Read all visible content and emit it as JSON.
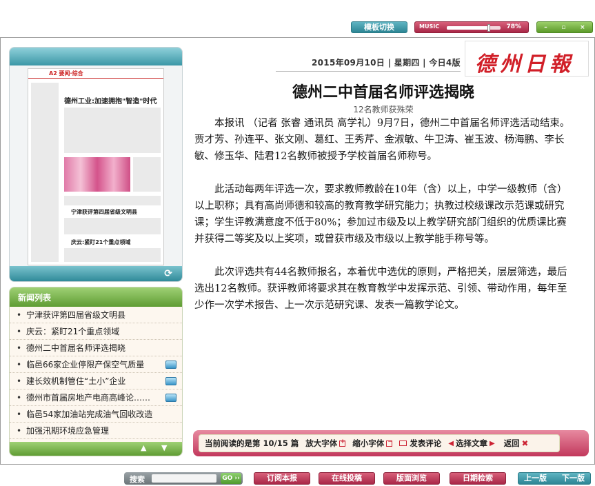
{
  "topbar": {
    "template_switch": "模板切换",
    "music_label": "MUSIC",
    "music_volume_text": "78%",
    "music_volume": 0.78,
    "window_controls": [
      "–",
      "▫",
      "×"
    ]
  },
  "header": {
    "date": "2015年09月10日",
    "weekday": "星期四",
    "today_pages": "今日4版",
    "logo": "德州日報"
  },
  "thumbnail": {
    "page_label": "A2 要闻·综合",
    "headline1": "德州工业:加速拥抱\"智造\"时代",
    "headline2": "宁津获评第四届省级文明县",
    "headline3": "庆云:紧盯21个重点领域"
  },
  "news_list": {
    "title": "新闻列表",
    "items": [
      {
        "text": "宁津获评第四届省级文明县",
        "video": false
      },
      {
        "text": "庆云：紧盯21个重点领域",
        "video": false
      },
      {
        "text": "德州二中首届名师评选揭晓",
        "video": false
      },
      {
        "text": "临邑66家企业停限产保空气质量",
        "video": true
      },
      {
        "text": "建长效机制管住“土小”企业",
        "video": true
      },
      {
        "text": "德州市首届房地产电商高峰论……",
        "video": true
      },
      {
        "text": "临邑54家加油站完成油气回收改造",
        "video": false
      },
      {
        "text": "加强汛期环境应急管理",
        "video": false
      }
    ]
  },
  "article": {
    "title": "德州二中首届名师评选揭晓",
    "subtitle": "12名教师获殊荣",
    "paragraphs": [
      "本报讯 （记者 张睿 通讯员 高学礼）9月7日，德州二中首届名师评选活动结束。贾才芳、孙连平、张文刚、葛红、王秀芹、金淑敏、牛卫涛、崔玉波、杨海鹏、李长敏、修玉华、陆君12名教师被授予学校首届名师称号。",
      "此活动每两年评选一次，要求教师教龄在10年（含）以上，中学一级教师（含）以上职称；具有高尚师德和较高的教育教学研究能力；执教过校级课改示范课或研究课；学生评教满意度不低于80%；参加过市级及以上教学研究部门组织的优质课比赛并获得二等奖及以上奖项，或曾获市级及市级以上教学能手称号等。",
      "此次评选共有44名教师报名，本着优中选优的原则，严格把关，层层筛选，最后选出12名教师。获评教师将要求其在教育教学中发挥示范、引领、带动作用，每年至少作一次学术报告、上一次示范研究课、发表一篇教学论文。"
    ]
  },
  "reading_bar": {
    "current_label": "当前阅读的是第",
    "current_value": "10/15",
    "current_unit": "篇",
    "enlarge": "放大字体",
    "shrink": "缩小字体",
    "comment": "发表评论",
    "select": "选择文章",
    "back": "返回"
  },
  "bottom_toolbar": {
    "search_label": "搜索",
    "search_placeholder": "",
    "go": "GO ››",
    "subscribe": "订阅本报",
    "submit": "在线投稿",
    "browse": "版面浏览",
    "date_search": "日期检索",
    "prev": "上一版",
    "next": "下一版"
  },
  "colors": {
    "teal": "#2d8594",
    "crimson": "#a82747",
    "green": "#5f9c33",
    "logo_red": "#d11f28"
  }
}
